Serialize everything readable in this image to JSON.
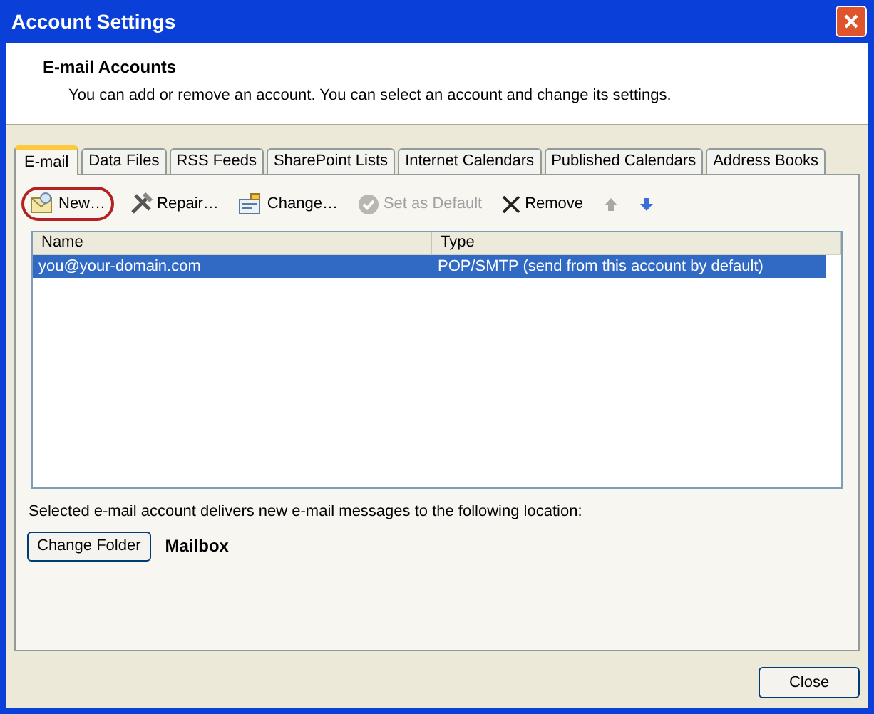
{
  "window": {
    "title": "Account Settings"
  },
  "header": {
    "title": "E-mail Accounts",
    "description": "You can add or remove an account. You can select an account and change its settings."
  },
  "tabs": [
    {
      "label": "E-mail",
      "selected": true
    },
    {
      "label": "Data Files",
      "selected": false
    },
    {
      "label": "RSS Feeds",
      "selected": false
    },
    {
      "label": "SharePoint Lists",
      "selected": false
    },
    {
      "label": "Internet Calendars",
      "selected": false
    },
    {
      "label": "Published Calendars",
      "selected": false
    },
    {
      "label": "Address Books",
      "selected": false
    }
  ],
  "toolbar": [
    {
      "kind": "new",
      "label": "New…",
      "disabled": false,
      "circled": true
    },
    {
      "kind": "repair",
      "label": "Repair…",
      "disabled": false,
      "circled": false
    },
    {
      "kind": "change",
      "label": "Change…",
      "disabled": false,
      "circled": false
    },
    {
      "kind": "default",
      "label": "Set as Default",
      "disabled": true,
      "circled": false
    },
    {
      "kind": "remove",
      "label": "Remove",
      "disabled": false,
      "circled": false
    },
    {
      "kind": "up",
      "disabled": true,
      "circled": false
    },
    {
      "kind": "down",
      "disabled": false,
      "circled": false
    }
  ],
  "table": {
    "columns": [
      "Name",
      "Type"
    ],
    "rows": [
      {
        "name": "you@your-domain.com",
        "type": "POP/SMTP (send from this account by default)",
        "selected": true
      }
    ]
  },
  "delivery": {
    "text": "Selected e-mail account delivers new e-mail messages to the following location:",
    "button": "Change Folder",
    "location": "Mailbox"
  },
  "buttons": [
    "Close"
  ]
}
